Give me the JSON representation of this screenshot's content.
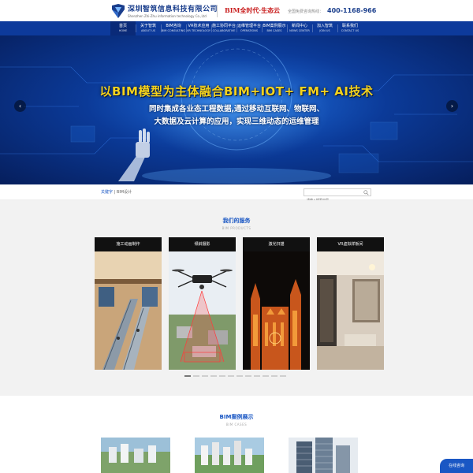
{
  "header": {
    "company_name": "深圳智筑信息科技有限公司",
    "company_name_en": "Shenzhen Zhi-Zhu information technology Co.,Ltd",
    "slogan": "BIM全时代·生态云",
    "hotline_label": "全国免费咨询热线：",
    "hotline": "400-1168-966"
  },
  "nav": {
    "items": [
      {
        "cn": "首页",
        "en": "HOME"
      },
      {
        "cn": "关于智筑",
        "en": "ABOUT US"
      },
      {
        "cn": "BIM咨询",
        "en": "BIM CONSULTING"
      },
      {
        "cn": "VR技术应用",
        "en": "VR TECHNOLOGY"
      },
      {
        "cn": "施工协同平台",
        "en": "COLLABORATIVE"
      },
      {
        "cn": "运维管理平台",
        "en": "OPERATIONS"
      },
      {
        "cn": "BIM案例展示",
        "en": "BIM CASES"
      },
      {
        "cn": "新闻中心",
        "en": "NEWS CENTER"
      },
      {
        "cn": "加入智筑",
        "en": "JOIN US"
      },
      {
        "cn": "联系我们",
        "en": "CONTACT US"
      }
    ],
    "active_index": 0
  },
  "banner": {
    "title": "以BIM模型为主体融合BIM+IOT+ FM+ AI技术",
    "line1": "同时集成各业态工程数据,通过移动互联网、物联网、",
    "line2": "大数据及云计算的应用，实现三维动态的运维管理",
    "prev_icon": "‹",
    "next_icon": "›",
    "slides": 5,
    "active_slide": 0
  },
  "breadcrumb": {
    "home": "关键字",
    "separator": " | ",
    "current": "BIM设计"
  },
  "search": {
    "placeholder": "请输入搜索内容"
  },
  "services": {
    "title": "我们的服务",
    "subtitle": "BIM PRODUCTS",
    "cards": [
      {
        "label": "施工动画制作"
      },
      {
        "label": "倾斜摄影"
      },
      {
        "label": "激光扫描"
      },
      {
        "label": "VR虚拟样板间"
      }
    ],
    "dot_count": 12,
    "active_dot": 0
  },
  "cases": {
    "title": "BIM案例展示",
    "subtitle": "BIM CASES"
  },
  "consult": {
    "label": "在线咨询"
  },
  "colors": {
    "brand_blue": "#0d3a9b",
    "link_blue": "#1a57c4",
    "banner_title": "#f5d21c",
    "slogan_red": "#c81d1d"
  }
}
